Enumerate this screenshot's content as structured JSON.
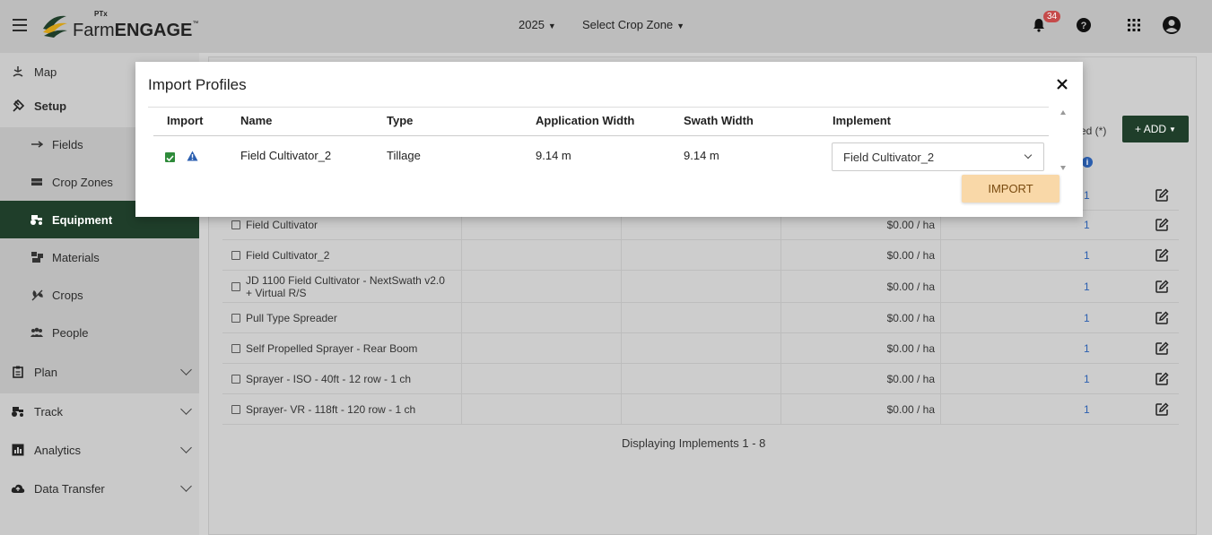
{
  "app": {
    "logo_prefix": "PTx",
    "logo_farm": "Farm",
    "logo_engage": "ENGAGE",
    "logo_tm": "™"
  },
  "topbar": {
    "year": "2025",
    "crop_zone": "Select Crop Zone",
    "notification_count": "34",
    "icons": [
      "menu-icon",
      "bell-icon",
      "help-icon",
      "apps-grid-icon",
      "user-icon"
    ]
  },
  "sidebar": {
    "items": [
      {
        "label": "Map",
        "icon": "map-icon"
      },
      {
        "label": "Setup",
        "icon": "setup-icon"
      },
      {
        "label": "Fields",
        "icon": "fields-icon"
      },
      {
        "label": "Crop Zones",
        "icon": "crop-zones-icon"
      },
      {
        "label": "Equipment",
        "icon": "tractor-icon"
      },
      {
        "label": "Materials",
        "icon": "materials-icon"
      },
      {
        "label": "Crops",
        "icon": "crops-icon"
      },
      {
        "label": "People",
        "icon": "people-icon"
      },
      {
        "label": "Plan",
        "icon": "clipboard-icon"
      },
      {
        "label": "Track",
        "icon": "tractor-icon"
      },
      {
        "label": "Analytics",
        "icon": "analytics-icon"
      },
      {
        "label": "Data Transfer",
        "icon": "cloud-upload-icon"
      }
    ]
  },
  "main": {
    "add_label": "+ ADD",
    "required_note": "ed (*)",
    "footer": "Displaying Implements 1 - 8",
    "rows": [
      {
        "name": "Field Cultivator",
        "cost": "$0.00 / ha",
        "count": "1"
      },
      {
        "name": "Field Cultivator_2",
        "cost": "$0.00 / ha",
        "count": "1"
      },
      {
        "name": "JD 1100 Field Cultivator - NextSwath v2.0 + Virtual R/S",
        "cost": "$0.00 / ha",
        "count": "1"
      },
      {
        "name": "Pull Type Spreader",
        "cost": "$0.00 / ha",
        "count": "1"
      },
      {
        "name": "Self Propelled Sprayer - Rear Boom",
        "cost": "$0.00 / ha",
        "count": "1"
      },
      {
        "name": "Sprayer - ISO - 40ft - 12 row - 1 ch",
        "cost": "$0.00 / ha",
        "count": "1"
      },
      {
        "name": "Sprayer- VR - 118ft - 120 row - 1 ch",
        "cost": "$0.00 / ha",
        "count": "1"
      }
    ],
    "first_row_count": "1"
  },
  "modal": {
    "title": "Import Profiles",
    "columns": [
      "Import",
      "Name",
      "Type",
      "Application Width",
      "Swath Width",
      "Implement"
    ],
    "row": {
      "name": "Field Cultivator_2",
      "type": "Tillage",
      "application_width": "9.14 m",
      "swath_width": "9.14 m",
      "implement": "Field Cultivator_2",
      "checked": true
    },
    "import_label": "IMPORT",
    "colors": {
      "import_button": "#f9d8a8",
      "checkbox": "#2e8b3a",
      "warning": "#2b5fb0"
    }
  }
}
